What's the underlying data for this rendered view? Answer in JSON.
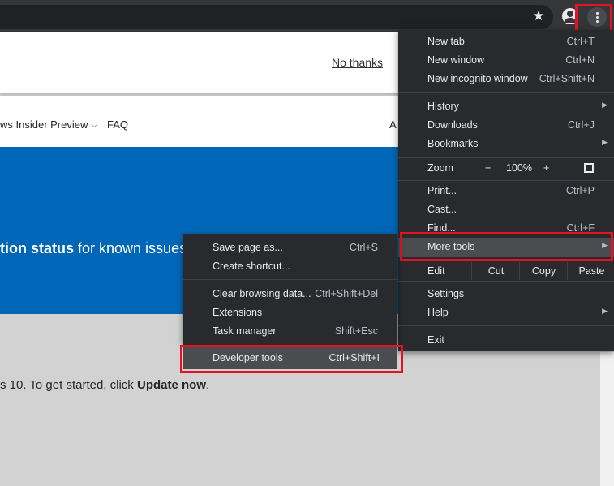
{
  "page": {
    "no_thanks": "No thanks",
    "nav": {
      "insider_preview": "ws Insider Preview",
      "faq": "FAQ",
      "cut_item": "A"
    },
    "hero": {
      "bold": "tion status",
      "rest": " for known issues"
    },
    "body": {
      "pre": "s 10. To get started, click ",
      "bold": "Update now",
      "post": "."
    }
  },
  "menu": {
    "new_tab": {
      "label": "New tab",
      "shortcut": "Ctrl+T"
    },
    "new_window": {
      "label": "New window",
      "shortcut": "Ctrl+N"
    },
    "new_incognito": {
      "label": "New incognito window",
      "shortcut": "Ctrl+Shift+N"
    },
    "history": {
      "label": "History"
    },
    "downloads": {
      "label": "Downloads",
      "shortcut": "Ctrl+J"
    },
    "bookmarks": {
      "label": "Bookmarks"
    },
    "zoom": {
      "label": "Zoom",
      "minus": "−",
      "value": "100%",
      "plus": "+"
    },
    "print": {
      "label": "Print...",
      "shortcut": "Ctrl+P"
    },
    "cast": {
      "label": "Cast..."
    },
    "find": {
      "label": "Find...",
      "shortcut": "Ctrl+F"
    },
    "more_tools": {
      "label": "More tools"
    },
    "edit": {
      "label": "Edit",
      "cut": "Cut",
      "copy": "Copy",
      "paste": "Paste"
    },
    "settings": {
      "label": "Settings"
    },
    "help": {
      "label": "Help"
    },
    "exit": {
      "label": "Exit"
    }
  },
  "submenu": {
    "save_page": {
      "label": "Save page as...",
      "shortcut": "Ctrl+S"
    },
    "create_shortcut": {
      "label": "Create shortcut..."
    },
    "clear_data": {
      "label": "Clear browsing data...",
      "shortcut": "Ctrl+Shift+Del"
    },
    "extensions": {
      "label": "Extensions"
    },
    "task_manager": {
      "label": "Task manager",
      "shortcut": "Shift+Esc"
    },
    "dev_tools": {
      "label": "Developer tools",
      "shortcut": "Ctrl+Shift+I"
    }
  },
  "icons": {
    "star": "★",
    "arrow": "▶",
    "chevron": "⌵"
  },
  "colors": {
    "highlight": "#e81123",
    "hero": "#0067b8",
    "menu_bg": "#292a2d"
  }
}
